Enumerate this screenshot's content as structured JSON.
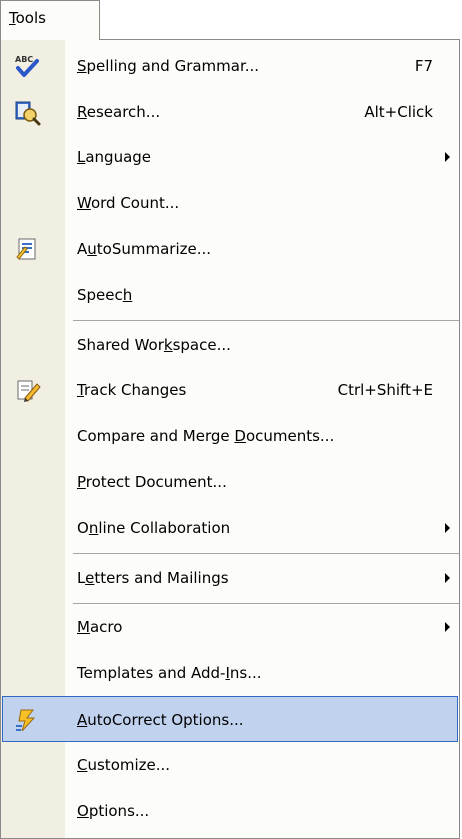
{
  "menu_title": {
    "before": "",
    "key": "T",
    "after": "ools"
  },
  "items": [
    {
      "id": "spelling",
      "before": "",
      "key": "S",
      "after": "pelling and Grammar...",
      "shortcut": "F7",
      "icon": "spelling-abc-check-icon"
    },
    {
      "id": "research",
      "before": "",
      "key": "R",
      "after": "esearch...",
      "shortcut": "Alt+Click",
      "icon": "research-book-magnifier-icon"
    },
    {
      "id": "language",
      "before": "",
      "key": "L",
      "after": "anguage",
      "submenu": true
    },
    {
      "id": "word-count",
      "before": "",
      "key": "W",
      "after": "ord Count..."
    },
    {
      "id": "autosummarize",
      "before": "A",
      "key": "u",
      "after": "toSummarize...",
      "icon": "autosummarize-icon"
    },
    {
      "id": "speech",
      "before": "Speec",
      "key": "h",
      "after": ""
    },
    {
      "id": "shared-workspace",
      "before": "Shared Wor",
      "key": "k",
      "after": "space..."
    },
    {
      "id": "track-changes",
      "before": "",
      "key": "T",
      "after": "rack Changes",
      "shortcut": "Ctrl+Shift+E",
      "icon": "track-changes-pencil-icon"
    },
    {
      "id": "compare-merge",
      "before": "Compare and Merge ",
      "key": "D",
      "after": "ocuments..."
    },
    {
      "id": "protect-document",
      "before": "",
      "key": "P",
      "after": "rotect Document..."
    },
    {
      "id": "online-collaboration",
      "before": "O",
      "key": "n",
      "after": "line Collaboration",
      "submenu": true
    },
    {
      "id": "letters-mailings",
      "before": "L",
      "key": "e",
      "after": "tters and Mailings",
      "submenu": true
    },
    {
      "id": "macro",
      "before": "",
      "key": "M",
      "after": "acro",
      "submenu": true
    },
    {
      "id": "templates-addins",
      "before": "Templates and Add-",
      "key": "I",
      "after": "ns..."
    },
    {
      "id": "autocorrect-options",
      "before": "",
      "key": "A",
      "after": "utoCorrect Options...",
      "icon": "autocorrect-lightning-icon",
      "highlighted": true
    },
    {
      "id": "customize",
      "before": "",
      "key": "C",
      "after": "ustomize..."
    },
    {
      "id": "options",
      "before": "",
      "key": "O",
      "after": "ptions..."
    }
  ],
  "colors": {
    "menu_background": "#fcfcf9",
    "icon_gutter": "#f1efe2",
    "highlight_fill": "#c1d2ee",
    "highlight_border": "#316ac5",
    "separator": "#a6a6a6"
  }
}
